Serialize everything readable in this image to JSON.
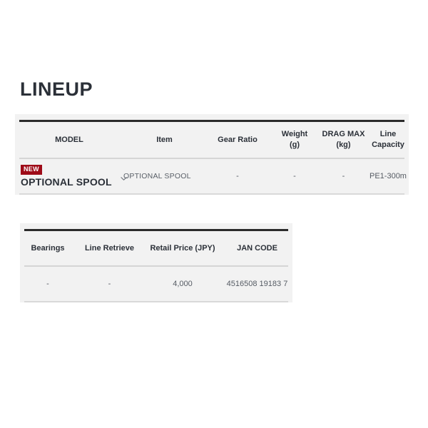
{
  "section": {
    "title": "LINEUP"
  },
  "lineup_table": {
    "headers": [
      {
        "label": "MODEL"
      },
      {
        "label": "Item"
      },
      {
        "label": "Gear Ratio"
      },
      {
        "label_line1": "Weight",
        "label_line2": "(g)"
      },
      {
        "label_line1": "DRAG MAX",
        "label_line2": "(kg)"
      },
      {
        "label": "Line Capacity"
      }
    ],
    "rows": [
      {
        "badge": "NEW",
        "model": "OPTIONAL SPOOL",
        "expander_icon": "chevron-down-icon",
        "item": "OPTIONAL SPOOL",
        "gear_ratio": "-",
        "weight_g": "-",
        "drag_max_kg": "-",
        "line_capacity": "PE1-300m"
      }
    ]
  },
  "price_table": {
    "headers": [
      {
        "label": "Bearings"
      },
      {
        "label": "Line Retrieve"
      },
      {
        "label": "Retail Price (JPY)"
      },
      {
        "label": "JAN CODE"
      }
    ],
    "rows": [
      {
        "bearings": "-",
        "line_retrieve": "-",
        "retail_price_jpy": "4,000",
        "jan_code": "4516508 19183 7"
      }
    ]
  },
  "colors": {
    "badge_new": "#9e0b18",
    "heading_text": "#2b3038",
    "table_background": "#f2f2f2",
    "rule_dark": "#2b2b2b",
    "rule_light": "#d5d5d5"
  }
}
